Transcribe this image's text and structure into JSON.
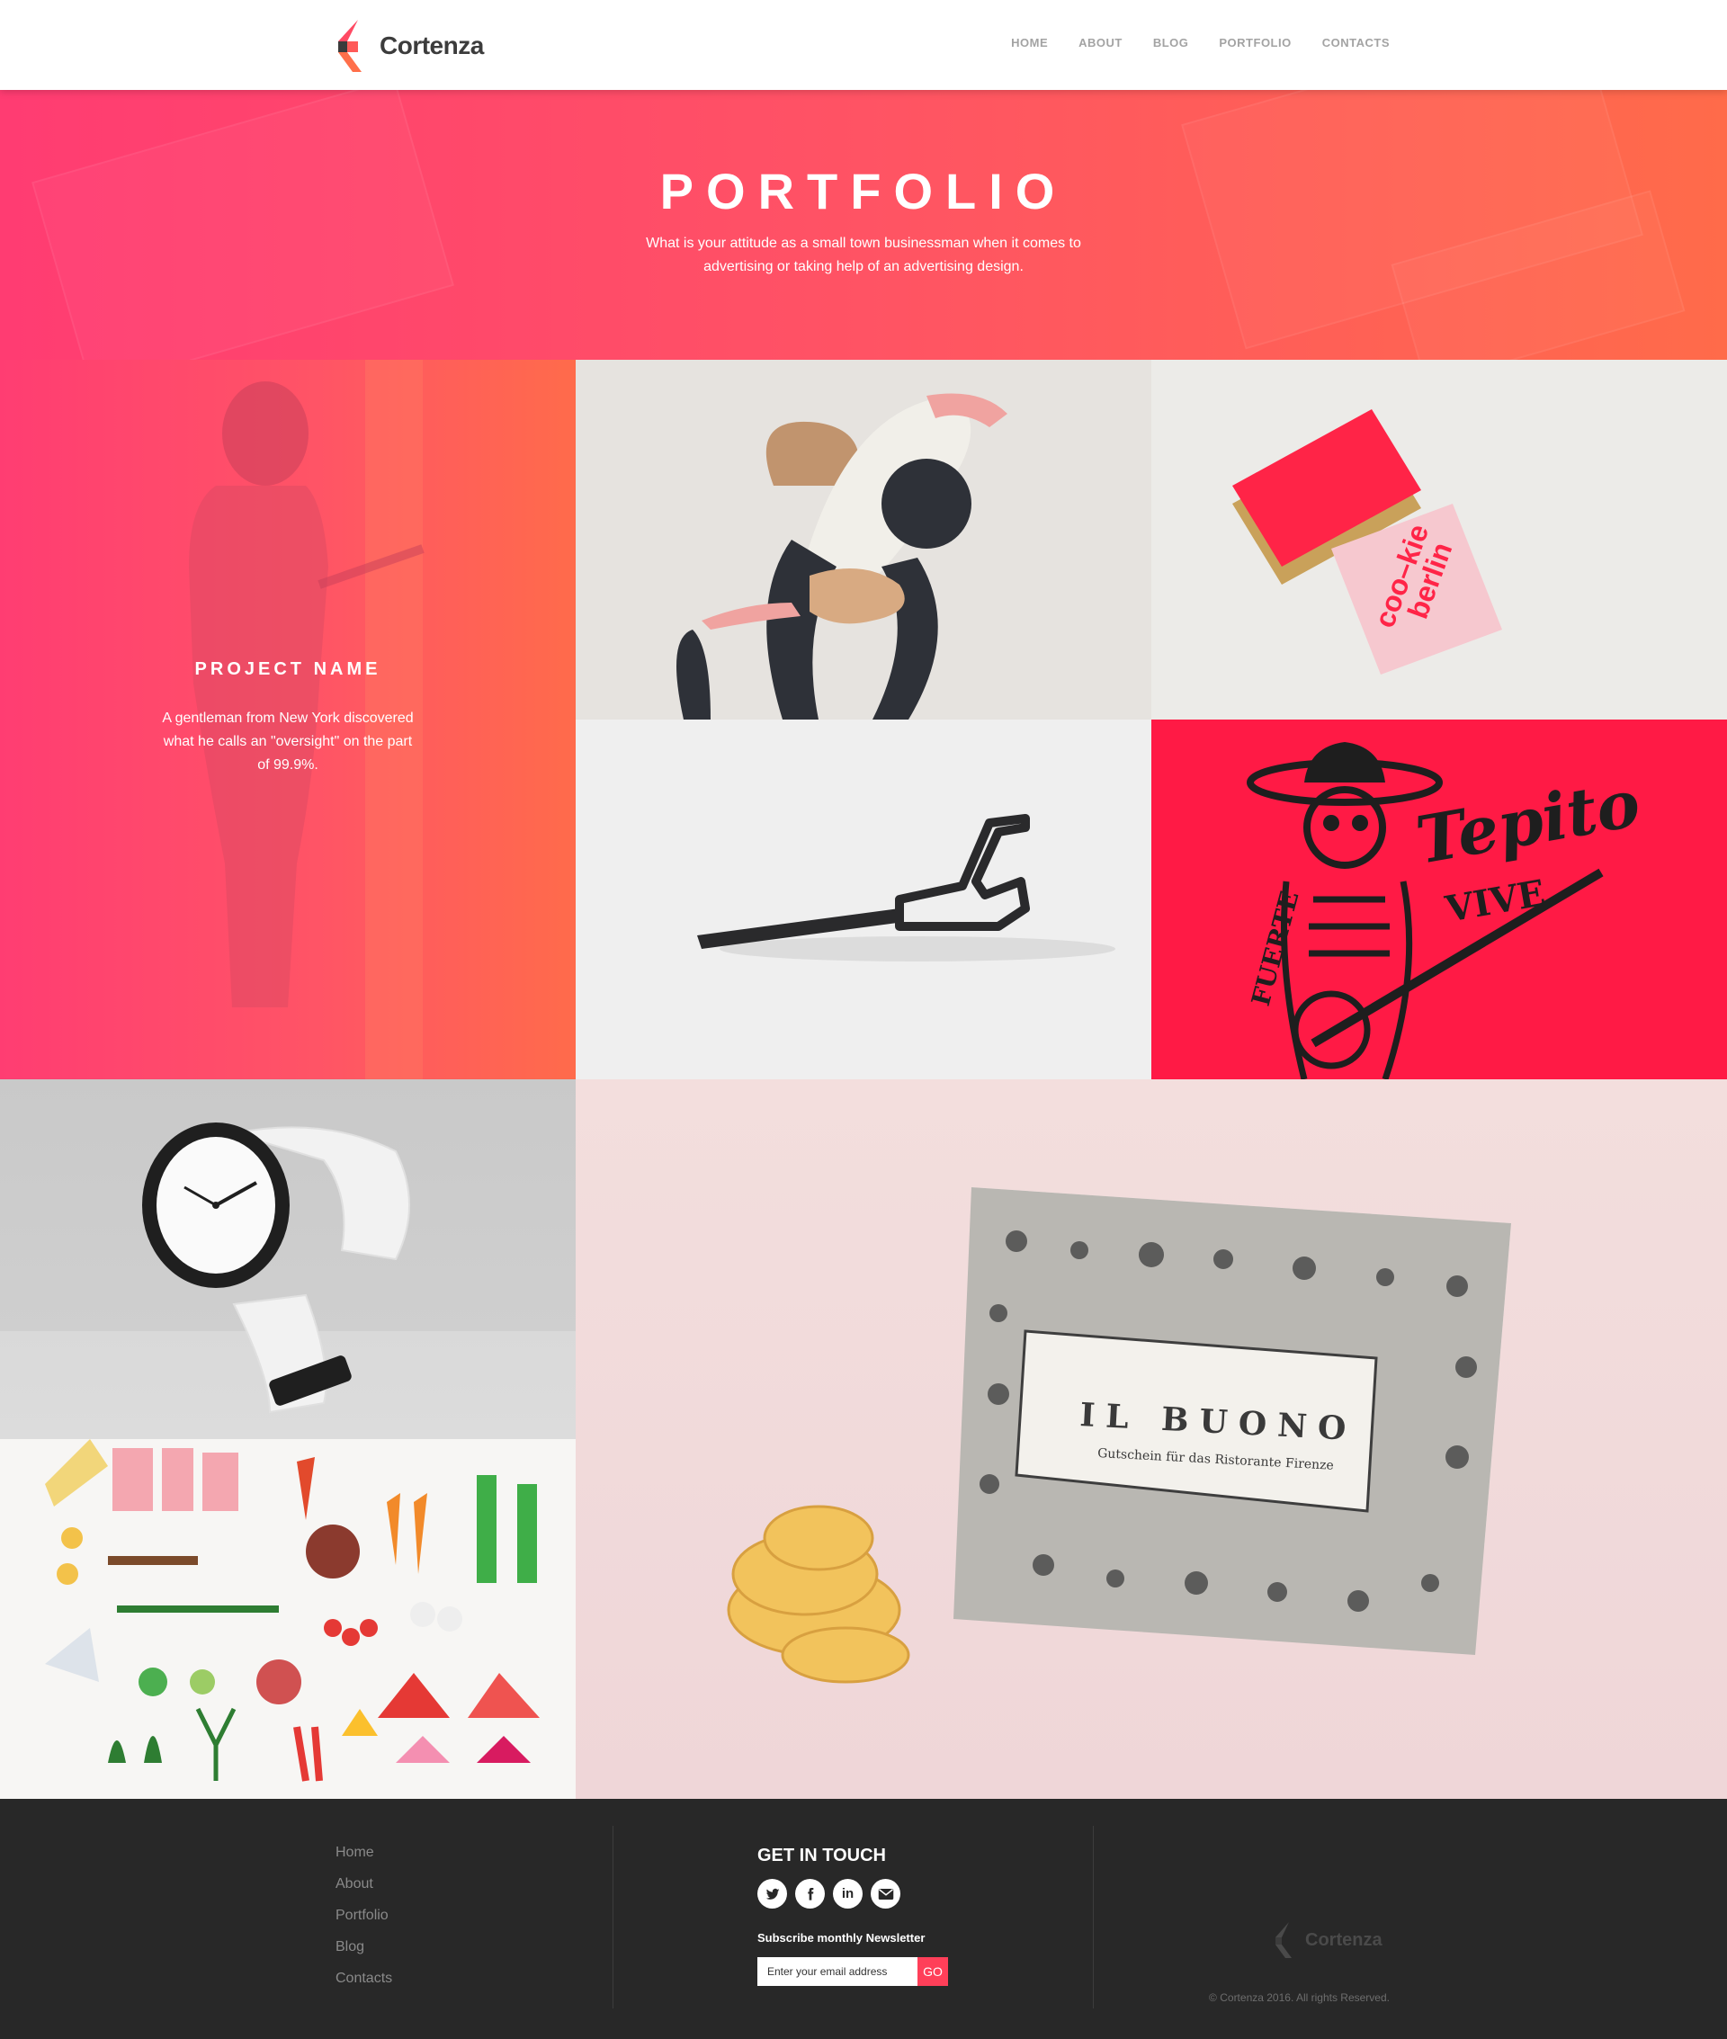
{
  "brand": {
    "name": "Cortenza",
    "accent": "#ff4f5e",
    "gradient_start": "#ff3c72",
    "gradient_end": "#ff6b4a"
  },
  "nav": {
    "items": [
      "HOME",
      "ABOUT",
      "BLOG",
      "PORTFOLIO",
      "CONTACTS"
    ]
  },
  "hero": {
    "title": "PORTFOLIO",
    "subtitle": "What is your attitude as a small town businessman when it comes to advertising or taking help of an advertising design."
  },
  "project": {
    "title": "PROJECT NAME",
    "description": "A gentleman from New York discovered what he calls an \"oversight\" on the part of 99.9%."
  },
  "tiles": {
    "card_text": [
      "coo–kie",
      "berlin"
    ],
    "tepito_text": [
      "Tepito",
      "VIVE",
      "FUERTE"
    ],
    "buono_title": "IL BUONO",
    "buono_subtitle": "Gutschein für das Ristorante Firenze"
  },
  "footer": {
    "links": [
      "Home",
      "About",
      "Portfolio",
      "Blog",
      "Contacts"
    ],
    "get_in_touch": "GET IN TOUCH",
    "socials": [
      "twitter-icon",
      "facebook-icon",
      "linkedin-icon",
      "mail-icon"
    ],
    "newsletter_label": "Subscribe monthly Newsletter",
    "newsletter_placeholder": "Enter your email address",
    "newsletter_button": "GO",
    "logo_text": "Cortenza",
    "copyright": "© Cortenza 2016. All rights Reserved."
  }
}
